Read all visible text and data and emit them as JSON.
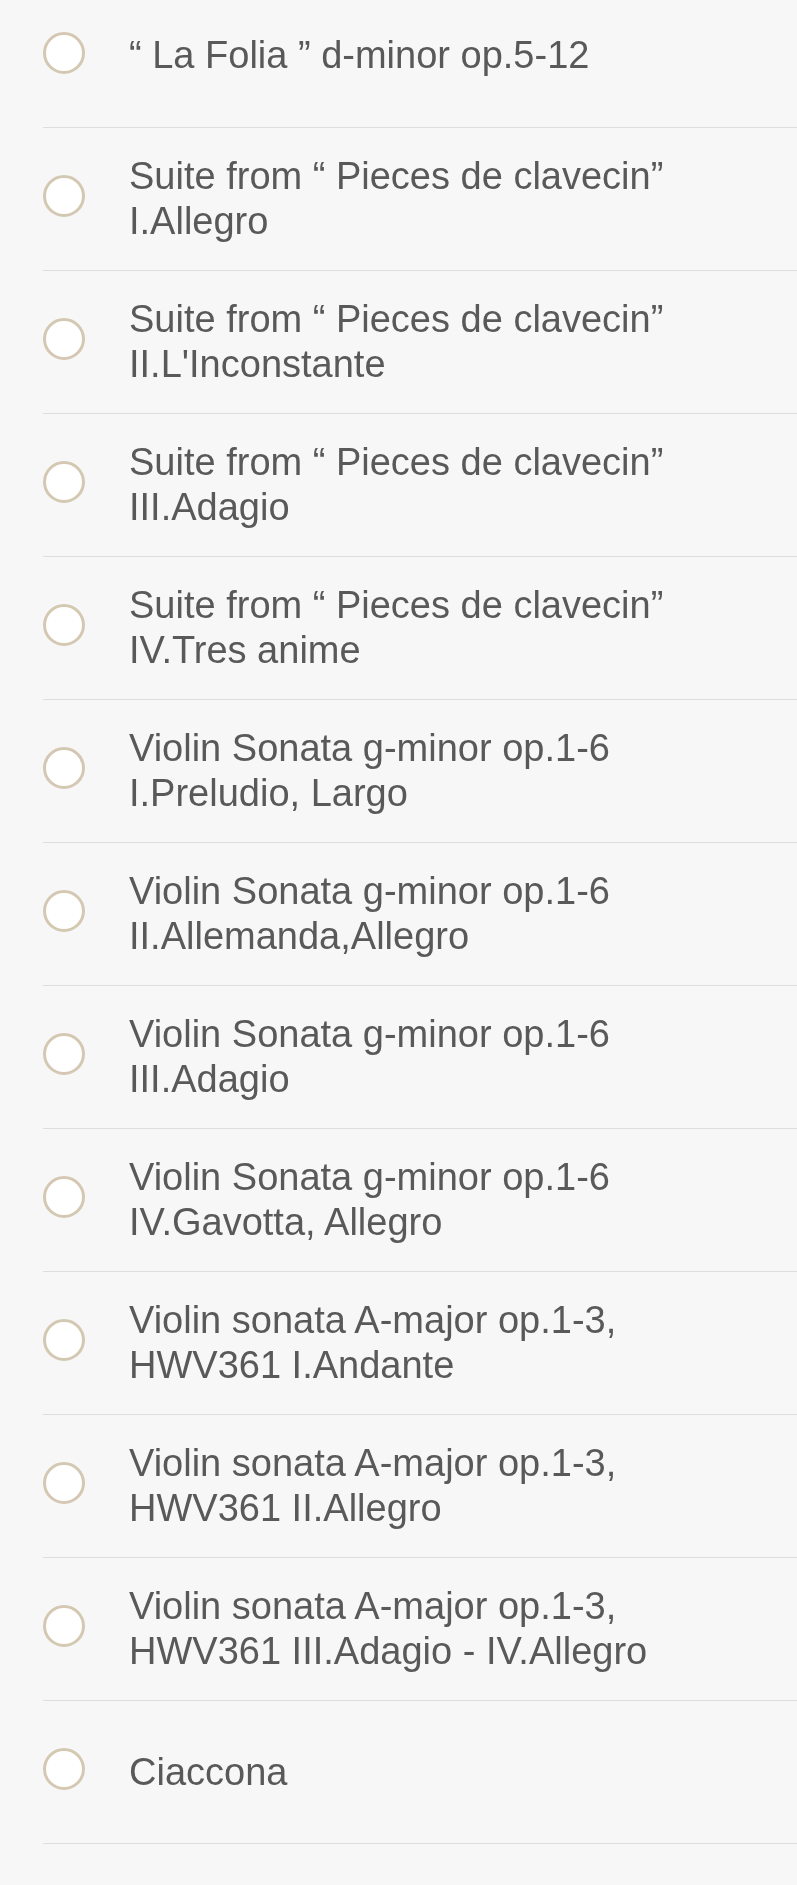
{
  "tracks": [
    {
      "title": "“ La Folia ” d-minor op.5-12",
      "selected": false
    },
    {
      "title": "Suite from “ Pieces de clavecin”\nI.Allegro",
      "selected": false
    },
    {
      "title": "Suite from “ Pieces de clavecin”\nII.L'Inconstante",
      "selected": false
    },
    {
      "title": "Suite from “ Pieces de clavecin”\nIII.Adagio",
      "selected": false
    },
    {
      "title": "Suite from “ Pieces de clavecin”\nIV.Tres anime",
      "selected": false
    },
    {
      "title": "Violin Sonata g-minor op.1-6\nI.Preludio, Largo",
      "selected": false
    },
    {
      "title": "Violin Sonata g-minor op.1-6\nII.Allemanda,Allegro",
      "selected": false
    },
    {
      "title": "Violin Sonata g-minor op.1-6\nIII.Adagio",
      "selected": false
    },
    {
      "title": "Violin Sonata g-minor op.1-6\nIV.Gavotta, Allegro",
      "selected": false
    },
    {
      "title": "Violin sonata A-major op.1-3,\nHWV361 I.Andante",
      "selected": false
    },
    {
      "title": "Violin sonata A-major op.1-3,\nHWV361 II.Allegro",
      "selected": false
    },
    {
      "title": "Violin sonata A-major op.1-3,\nHWV361 III.Adagio - IV.Allegro",
      "selected": false
    },
    {
      "title": "Ciaccona",
      "selected": false
    }
  ]
}
